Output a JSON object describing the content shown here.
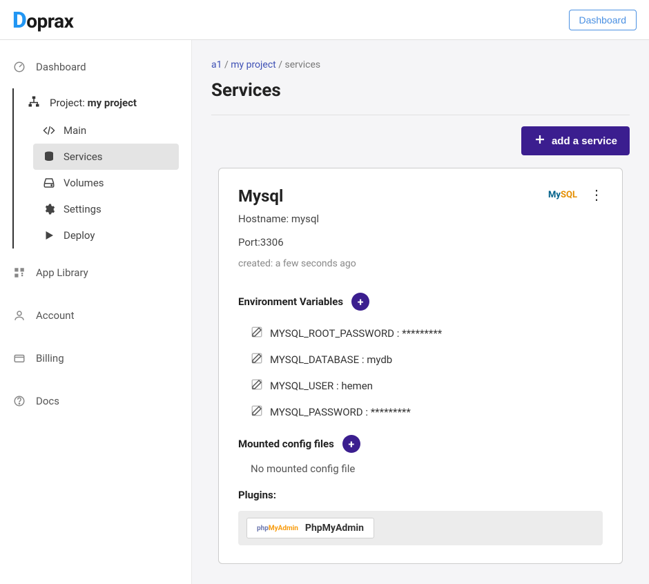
{
  "brand": "Doprax",
  "header": {
    "dashboard_btn": "Dashboard"
  },
  "sidebar": {
    "dashboard": "Dashboard",
    "project_label": "Project:",
    "project_name": "my project",
    "sub": {
      "main": "Main",
      "services": "Services",
      "volumes": "Volumes",
      "settings": "Settings",
      "deploy": "Deploy"
    },
    "app_library": "App Library",
    "account": "Account",
    "billing": "Billing",
    "docs": "Docs"
  },
  "breadcrumb": {
    "a1": "a1",
    "project": "my project",
    "services": "services"
  },
  "page": {
    "title": "Services",
    "add_btn": "add a service"
  },
  "service": {
    "title": "Mysql",
    "hostname_label": "Hostname:",
    "hostname_value": "mysql",
    "port_label": "Port:",
    "port_value": "3306",
    "created_label": "created:",
    "created_value": "a few seconds ago",
    "env_title": "Environment Variables",
    "env_vars": [
      {
        "key": "MYSQL_ROOT_PASSWORD",
        "value": "*********"
      },
      {
        "key": "MYSQL_DATABASE",
        "value": "mydb"
      },
      {
        "key": "MYSQL_USER",
        "value": "hemen"
      },
      {
        "key": "MYSQL_PASSWORD",
        "value": "*********"
      }
    ],
    "config_title": "Mounted config files",
    "config_empty": "No mounted config file",
    "plugins_title": "Plugins:",
    "plugin_name": "PhpMyAdmin"
  }
}
